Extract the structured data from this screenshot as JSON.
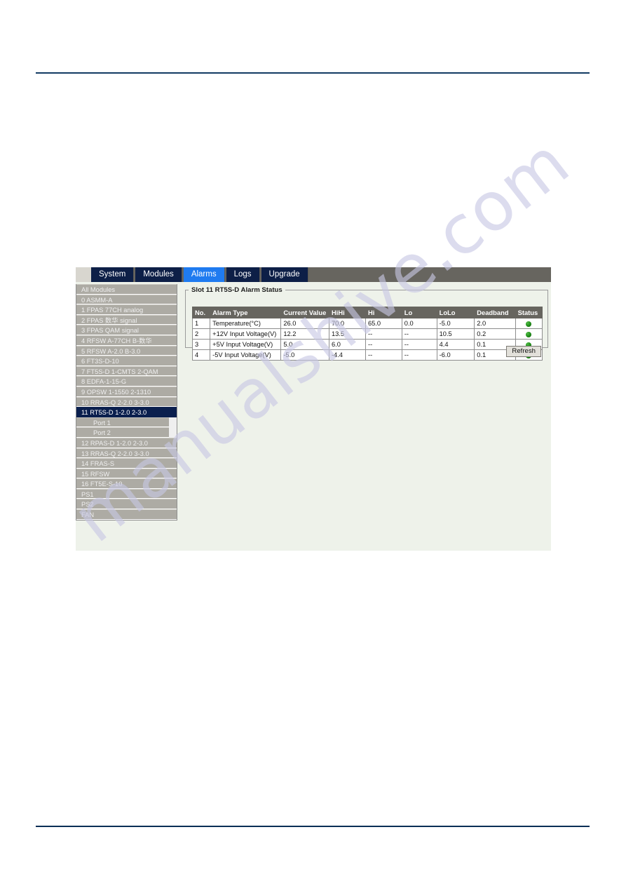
{
  "watermark": {
    "text": "manualshive.com"
  },
  "tabs": [
    {
      "label": "System",
      "active": false
    },
    {
      "label": "Modules",
      "active": false
    },
    {
      "label": "Alarms",
      "active": true
    },
    {
      "label": "Logs",
      "active": false
    },
    {
      "label": "Upgrade",
      "active": false
    }
  ],
  "sidebar": {
    "items": [
      {
        "label": "All Modules",
        "selected": false,
        "sub": false
      },
      {
        "label": "0 ASMM-A",
        "selected": false,
        "sub": false
      },
      {
        "label": "1 FPAS 77CH analog",
        "selected": false,
        "sub": false
      },
      {
        "label": "2 FPAS 数华 signal",
        "selected": false,
        "sub": false
      },
      {
        "label": "3 FPAS QAM signal",
        "selected": false,
        "sub": false
      },
      {
        "label": "4 RFSW A-77CH B-数华",
        "selected": false,
        "sub": false
      },
      {
        "label": "5 RFSW A-2.0 B-3.0",
        "selected": false,
        "sub": false
      },
      {
        "label": "6 FT3S-D-10",
        "selected": false,
        "sub": false
      },
      {
        "label": "7 FT5S-D 1-CMTS 2-QAM",
        "selected": false,
        "sub": false
      },
      {
        "label": "8 EDFA-1-15-G",
        "selected": false,
        "sub": false
      },
      {
        "label": "9 OPSW 1-1550 2-1310",
        "selected": false,
        "sub": false
      },
      {
        "label": "10 RRAS-Q 2-2.0 3-3.0",
        "selected": false,
        "sub": false
      },
      {
        "label": "11 RT5S-D 1-2.0 2-3.0",
        "selected": true,
        "sub": false
      },
      {
        "label": "Port 1",
        "selected": false,
        "sub": true
      },
      {
        "label": "Port 2",
        "selected": false,
        "sub": true
      },
      {
        "label": "12 RPAS-D 1-2.0 2-3.0",
        "selected": false,
        "sub": false
      },
      {
        "label": "13 RRAS-Q 2-2.0 3-3.0",
        "selected": false,
        "sub": false
      },
      {
        "label": "14 FRAS-S",
        "selected": false,
        "sub": false
      },
      {
        "label": "15 RFSW",
        "selected": false,
        "sub": false
      },
      {
        "label": "16 FT5E-S-10",
        "selected": false,
        "sub": false
      },
      {
        "label": "PS1",
        "selected": false,
        "sub": false
      },
      {
        "label": "PS2",
        "selected": false,
        "sub": false
      },
      {
        "label": "FAN",
        "selected": false,
        "sub": false
      }
    ]
  },
  "panel": {
    "legend": "Slot 11 RT5S-D Alarm Status",
    "refresh_label": "Refresh",
    "table": {
      "headers": [
        "No.",
        "Alarm Type",
        "Current Value",
        "HiHi",
        "Hi",
        "Lo",
        "LoLo",
        "Deadband",
        "Status"
      ],
      "rows": [
        {
          "no": "1",
          "type": "Temperature(°C)",
          "current": "26.0",
          "hihi": "70.0",
          "hi": "65.0",
          "lo": "0.0",
          "lolo": "-5.0",
          "deadband": "2.0",
          "status": "ok"
        },
        {
          "no": "2",
          "type": "+12V Input Voltage(V)",
          "current": "12.2",
          "hihi": "13.5",
          "hi": "--",
          "lo": "--",
          "lolo": "10.5",
          "deadband": "0.2",
          "status": "ok"
        },
        {
          "no": "3",
          "type": "+5V Input Voltage(V)",
          "current": "5.0",
          "hihi": "6.0",
          "hi": "--",
          "lo": "--",
          "lolo": "4.4",
          "deadband": "0.1",
          "status": "ok"
        },
        {
          "no": "4",
          "type": "-5V Input Voltage(V)",
          "current": "-5.0",
          "hihi": "-4.4",
          "hi": "--",
          "lo": "--",
          "lolo": "-6.0",
          "deadband": "0.1",
          "status": "ok"
        }
      ]
    }
  },
  "colors": {
    "tabbar_bg": "#67655f",
    "tab_bg": "#0d1f47",
    "tab_active_bg": "#1f7bf0",
    "sidebar_item_bg": "#adaba4",
    "sidebar_selected_bg": "#0a1f4e",
    "content_bg": "#eef2ea",
    "table_header_bg": "#67655f",
    "status_led_green": "#1e8a17",
    "rule": "#123a63"
  }
}
